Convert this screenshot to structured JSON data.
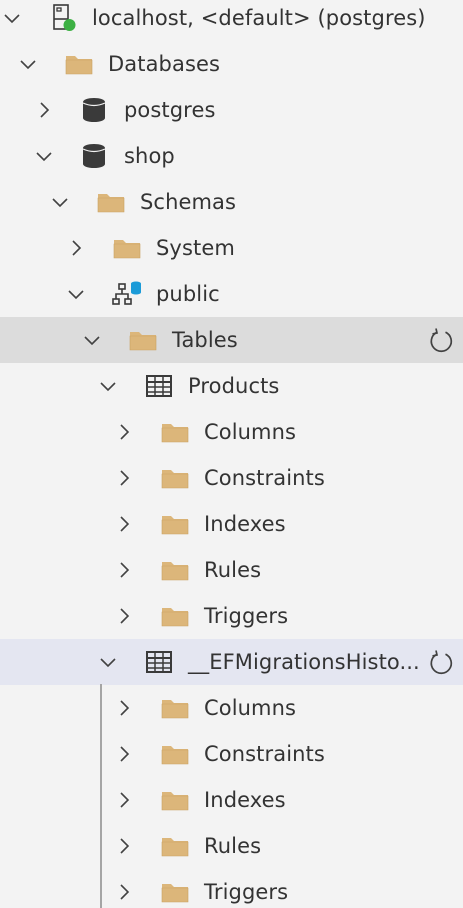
{
  "colors": {
    "folder": "#dcb67a",
    "server_status": "#3cb043",
    "db_icon": "#3a3a3a",
    "schema_db": "#1b9bd8",
    "selection_gray": "#dcdcdc",
    "selection_blue": "#e4e6f1"
  },
  "tree": [
    {
      "label": "localhost, <default> (postgres)",
      "icon": "server-icon",
      "depth": 0,
      "expanded": true
    },
    {
      "label": "Databases",
      "icon": "folder-icon",
      "depth": 1,
      "expanded": true
    },
    {
      "label": "postgres",
      "icon": "database-icon",
      "depth": 2,
      "expanded": false
    },
    {
      "label": "shop",
      "icon": "database-icon",
      "depth": 2,
      "expanded": true
    },
    {
      "label": "Schemas",
      "icon": "folder-icon",
      "depth": 3,
      "expanded": true
    },
    {
      "label": "System",
      "icon": "folder-icon",
      "depth": 4,
      "expanded": false
    },
    {
      "label": "public",
      "icon": "schema-icon",
      "depth": 4,
      "expanded": true
    },
    {
      "label": "Tables",
      "icon": "folder-icon",
      "depth": 5,
      "expanded": true,
      "highlight": "gray",
      "refresh": true
    },
    {
      "label": "Products",
      "icon": "table-icon",
      "depth": 6,
      "expanded": true
    },
    {
      "label": "Columns",
      "icon": "folder-icon",
      "depth": 7,
      "expanded": false
    },
    {
      "label": "Constraints",
      "icon": "folder-icon",
      "depth": 7,
      "expanded": false
    },
    {
      "label": "Indexes",
      "icon": "folder-icon",
      "depth": 7,
      "expanded": false
    },
    {
      "label": "Rules",
      "icon": "folder-icon",
      "depth": 7,
      "expanded": false
    },
    {
      "label": "Triggers",
      "icon": "folder-icon",
      "depth": 7,
      "expanded": false
    },
    {
      "label": "__EFMigrationsHisto...",
      "icon": "table-icon",
      "depth": 6,
      "expanded": true,
      "highlight": "blue",
      "refresh": true
    },
    {
      "label": "Columns",
      "icon": "folder-icon",
      "depth": 7,
      "expanded": false
    },
    {
      "label": "Constraints",
      "icon": "folder-icon",
      "depth": 7,
      "expanded": false
    },
    {
      "label": "Indexes",
      "icon": "folder-icon",
      "depth": 7,
      "expanded": false
    },
    {
      "label": "Rules",
      "icon": "folder-icon",
      "depth": 7,
      "expanded": false
    },
    {
      "label": "Triggers",
      "icon": "folder-icon",
      "depth": 7,
      "expanded": false
    }
  ]
}
